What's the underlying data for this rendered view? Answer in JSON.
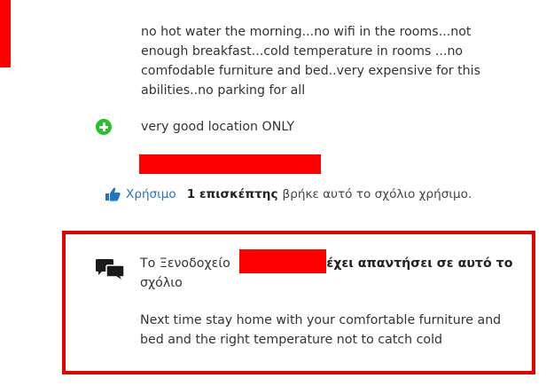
{
  "review": {
    "negative_text": "no hot water the morning...no wifi in the rooms...not enough breakfast...cold temperature in rooms ...no comfodable furniture and bed..very expensive for this abilities..no parking for all",
    "positive_text": "very good location ONLY",
    "colors": {
      "positive": "#22c428",
      "link": "#1f74c7",
      "redaction": "#ff0000"
    }
  },
  "helpful": {
    "icon": "thumbs-up-icon",
    "link_label": "Χρήσιμο",
    "count_label": "1 επισκέπτης",
    "suffix": "βρήκε αυτό το σχόλιο χρήσιμο."
  },
  "management_response": {
    "icon": "chat-bubbles-icon",
    "header_prefix": "Το Ξενοδοχείο",
    "header_bold": "έχει απαντήσει σε αυτό το",
    "header_suffix": "σχόλιο",
    "body": "Next time stay home with your comfortable furniture and bed and the right temperature not to catch cold",
    "border_color": "#e50000"
  }
}
